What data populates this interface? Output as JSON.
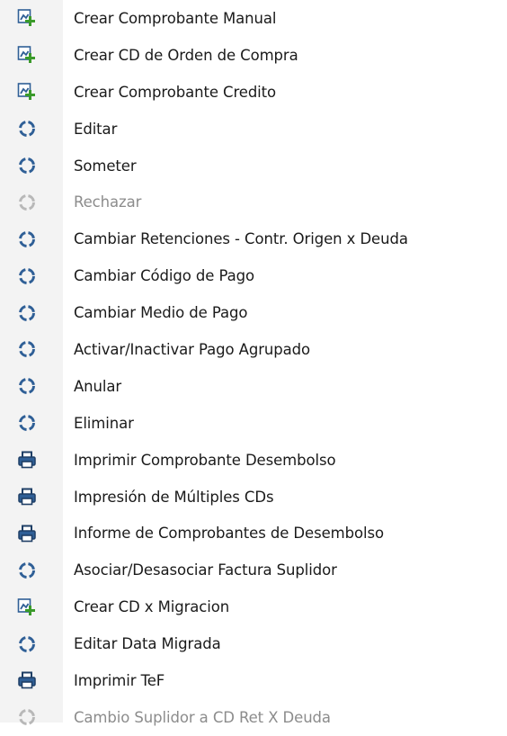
{
  "menu": {
    "items": [
      {
        "label": "Crear Comprobante Manual",
        "icon": "add-document-icon",
        "enabled": true
      },
      {
        "label": "Crear CD de Orden de Compra",
        "icon": "add-document-icon",
        "enabled": true
      },
      {
        "label": "Crear Comprobante Credito",
        "icon": "add-document-icon",
        "enabled": true
      },
      {
        "label": "Editar",
        "icon": "workflow-icon",
        "enabled": true
      },
      {
        "label": "Someter",
        "icon": "workflow-icon",
        "enabled": true
      },
      {
        "label": "Rechazar",
        "icon": "workflow-icon",
        "enabled": false
      },
      {
        "label": "Cambiar Retenciones - Contr. Origen x Deuda",
        "icon": "workflow-icon",
        "enabled": true
      },
      {
        "label": "Cambiar Código de Pago",
        "icon": "workflow-icon",
        "enabled": true
      },
      {
        "label": "Cambiar Medio de Pago",
        "icon": "workflow-icon",
        "enabled": true
      },
      {
        "label": "Activar/Inactivar Pago Agrupado",
        "icon": "workflow-icon",
        "enabled": true
      },
      {
        "label": "Anular",
        "icon": "workflow-icon",
        "enabled": true
      },
      {
        "label": "Eliminar",
        "icon": "workflow-icon",
        "enabled": true
      },
      {
        "label": "Imprimir Comprobante Desembolso",
        "icon": "printer-icon",
        "enabled": true
      },
      {
        "label": "Impresión de Múltiples CDs",
        "icon": "printer-icon",
        "enabled": true
      },
      {
        "label": "Informe de Comprobantes de Desembolso",
        "icon": "printer-icon",
        "enabled": true
      },
      {
        "label": "Asociar/Desasociar Factura Suplidor",
        "icon": "workflow-icon",
        "enabled": true
      },
      {
        "label": "Crear CD x Migracion",
        "icon": "add-document-icon",
        "enabled": true
      },
      {
        "label": "Editar Data Migrada",
        "icon": "workflow-icon",
        "enabled": true
      },
      {
        "label": "Imprimir TeF",
        "icon": "printer-icon",
        "enabled": true
      },
      {
        "label": "Cambio Suplidor a CD Ret X Deuda",
        "icon": "workflow-icon",
        "enabled": false
      }
    ]
  },
  "colors": {
    "icon_blue": "#2f5f96",
    "icon_disabled": "#b8b8b8",
    "add_green": "#3a9a2a",
    "text": "#1a1a1a",
    "text_disabled": "#8c8c8c",
    "gutter": "#f3f3f3"
  }
}
